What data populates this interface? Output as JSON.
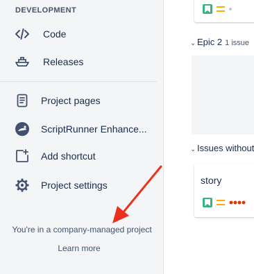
{
  "sidebar": {
    "section_title": "DEVELOPMENT",
    "items": [
      {
        "label": "Code",
        "icon": "code-icon"
      },
      {
        "label": "Releases",
        "icon": "ship-icon"
      },
      {
        "label": "Project pages",
        "icon": "document-icon"
      },
      {
        "label": "ScriptRunner Enhance...",
        "icon": "scriptrunner-icon"
      },
      {
        "label": "Add shortcut",
        "icon": "add-shortcut-icon"
      },
      {
        "label": "Project settings",
        "icon": "gear-icon"
      }
    ],
    "company_text": "You're in a company-managed project",
    "learn_more": "Learn more"
  },
  "board": {
    "groups": [
      {
        "label": "Epic 2",
        "count": "1 issue"
      },
      {
        "label": "Issues without",
        "count": ""
      }
    ],
    "story_card": {
      "title": "story"
    }
  },
  "colors": {
    "story_green": "#36b37e",
    "priority_medium": "#ffab00",
    "arrow_red": "#e8321e",
    "dots_red": "#de350b"
  }
}
